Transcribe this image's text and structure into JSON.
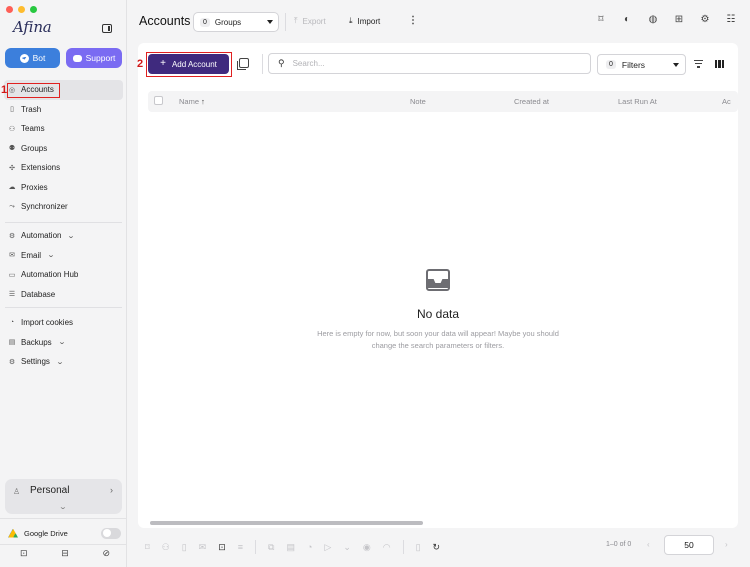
{
  "sidebar": {
    "logo_text": "Afina",
    "bot_label": "Bot",
    "support_label": "Support",
    "items": [
      {
        "label": "Accounts",
        "icon": "user-circle-icon"
      },
      {
        "label": "Trash",
        "icon": "trash-icon"
      },
      {
        "label": "Teams",
        "icon": "team-icon"
      },
      {
        "label": "Groups",
        "icon": "groups-icon"
      },
      {
        "label": "Extensions",
        "icon": "puzzle-icon"
      },
      {
        "label": "Proxies",
        "icon": "cloud-icon"
      },
      {
        "label": "Synchronizer",
        "icon": "sync-icon"
      },
      {
        "label": "Automation",
        "icon": "automation-icon"
      },
      {
        "label": "Email",
        "icon": "mail-icon"
      },
      {
        "label": "Automation Hub",
        "icon": "laptop-icon"
      },
      {
        "label": "Database",
        "icon": "database-icon"
      },
      {
        "label": "Import cookies",
        "icon": "cookie-icon"
      },
      {
        "label": "Backups",
        "icon": "backup-icon"
      },
      {
        "label": "Settings",
        "icon": "gear-icon"
      }
    ],
    "profile_label": "Personal",
    "gdrive_label": "Google Drive",
    "gdrive_enabled": false
  },
  "annotations": {
    "step1": "1",
    "step2": "2",
    "highlight_color": "#e02020"
  },
  "header": {
    "title": "Accounts",
    "groups_count": "0",
    "groups_label": "Groups",
    "export_label": "Export",
    "import_label": "Import"
  },
  "toolbar": {
    "add_account_label": "Add Account",
    "search_placeholder": "Search...",
    "filters_count": "0",
    "filters_label": "Filters"
  },
  "table": {
    "columns": [
      "Name",
      "Note",
      "Created at",
      "Last Run At",
      "Ac"
    ],
    "sort_indicator": "↑",
    "rows": []
  },
  "empty_state": {
    "title": "No data",
    "line1": "Here is empty for now, but soon your data will appear! Maybe you should",
    "line2": "change the search parameters or filters."
  },
  "pagination": {
    "range_text": "1–0 of 0",
    "page_size": "50"
  },
  "colors": {
    "accent": "#3f2a7e",
    "bot": "#3c7fdc",
    "support": "#7a6bf2"
  }
}
